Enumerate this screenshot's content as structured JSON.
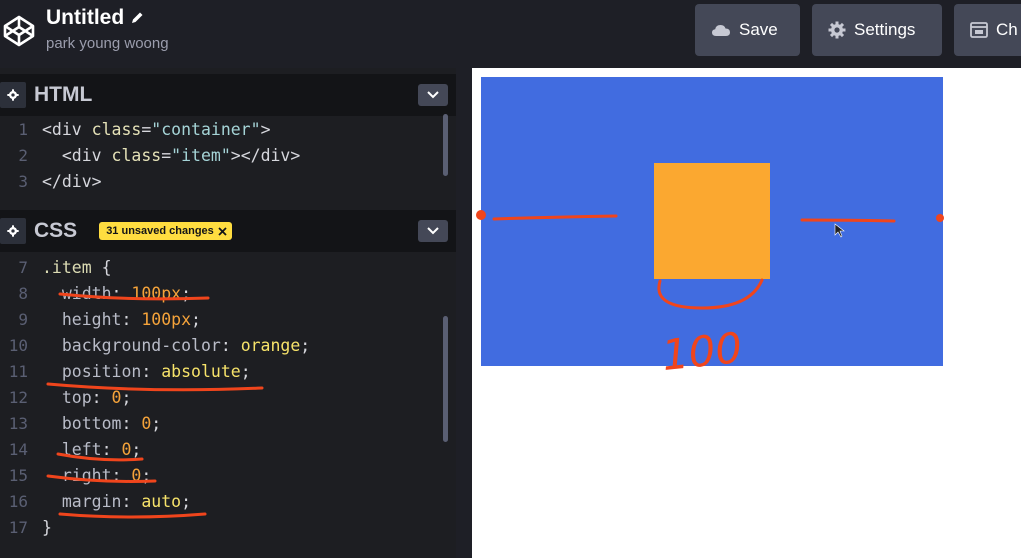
{
  "header": {
    "title": "Untitled",
    "author": "park young woong",
    "buttons": {
      "save": "Save",
      "settings": "Settings",
      "change_view": "Ch"
    }
  },
  "html_panel": {
    "title": "HTML",
    "lines": [
      {
        "n": "1",
        "tokens": [
          [
            "t-tag",
            "<div "
          ],
          [
            "t-attr",
            "class"
          ],
          [
            "t-tag",
            "="
          ],
          [
            "t-str",
            "\"container\""
          ],
          [
            "t-tag",
            ">"
          ]
        ]
      },
      {
        "n": "2",
        "tokens": [
          [
            "t-tag",
            "  <div "
          ],
          [
            "t-attr",
            "class"
          ],
          [
            "t-tag",
            "="
          ],
          [
            "t-str",
            "\"item\""
          ],
          [
            "t-tag",
            "></div>"
          ]
        ]
      },
      {
        "n": "3",
        "tokens": [
          [
            "t-tag",
            "</div>"
          ]
        ]
      }
    ]
  },
  "css_panel": {
    "title": "CSS",
    "badge": "31 unsaved changes",
    "lines": [
      {
        "n": "7",
        "tokens": [
          [
            "t-sel",
            ".item "
          ],
          [
            "t-pun",
            "{"
          ]
        ]
      },
      {
        "n": "8",
        "tokens": [
          [
            "t-prop",
            "  width"
          ],
          [
            "t-pun",
            ": "
          ],
          [
            "t-num",
            "100px"
          ],
          [
            "t-pun",
            ";"
          ]
        ]
      },
      {
        "n": "9",
        "tokens": [
          [
            "t-prop",
            "  height"
          ],
          [
            "t-pun",
            ": "
          ],
          [
            "t-num",
            "100px"
          ],
          [
            "t-pun",
            ";"
          ]
        ]
      },
      {
        "n": "10",
        "tokens": [
          [
            "t-prop",
            "  background-color"
          ],
          [
            "t-pun",
            ": "
          ],
          [
            "t-kw",
            "orange"
          ],
          [
            "t-pun",
            ";"
          ]
        ]
      },
      {
        "n": "11",
        "tokens": [
          [
            "t-prop",
            "  position"
          ],
          [
            "t-pun",
            ": "
          ],
          [
            "t-kw",
            "absolute"
          ],
          [
            "t-pun",
            ";"
          ]
        ]
      },
      {
        "n": "12",
        "tokens": [
          [
            "t-prop",
            "  top"
          ],
          [
            "t-pun",
            ": "
          ],
          [
            "t-num",
            "0"
          ],
          [
            "t-pun",
            ";"
          ]
        ]
      },
      {
        "n": "13",
        "tokens": [
          [
            "t-prop",
            "  bottom"
          ],
          [
            "t-pun",
            ": "
          ],
          [
            "t-num",
            "0"
          ],
          [
            "t-pun",
            ";"
          ]
        ]
      },
      {
        "n": "14",
        "tokens": [
          [
            "t-prop",
            "  left"
          ],
          [
            "t-pun",
            ": "
          ],
          [
            "t-num",
            "0"
          ],
          [
            "t-pun",
            ";"
          ]
        ]
      },
      {
        "n": "15",
        "tokens": [
          [
            "t-prop",
            "  right"
          ],
          [
            "t-pun",
            ": "
          ],
          [
            "t-num",
            "0"
          ],
          [
            "t-pun",
            ";"
          ]
        ]
      },
      {
        "n": "16",
        "tokens": [
          [
            "t-prop",
            "  margin"
          ],
          [
            "t-pun",
            ": "
          ],
          [
            "t-kw",
            "auto"
          ],
          [
            "t-pun",
            ";"
          ]
        ]
      },
      {
        "n": "17",
        "tokens": [
          [
            "t-pun",
            "}"
          ]
        ]
      }
    ]
  },
  "preview": {
    "annotation_text": "100"
  },
  "colors": {
    "container": "#416ce0",
    "item": "#fba830",
    "annotation": "#f0451c",
    "badge": "#ffdd40"
  },
  "icons": [
    "codepen-logo-icon",
    "pencil-icon",
    "cloud-icon",
    "gear-icon",
    "layout-icon",
    "chevron-down-icon",
    "close-icon"
  ]
}
